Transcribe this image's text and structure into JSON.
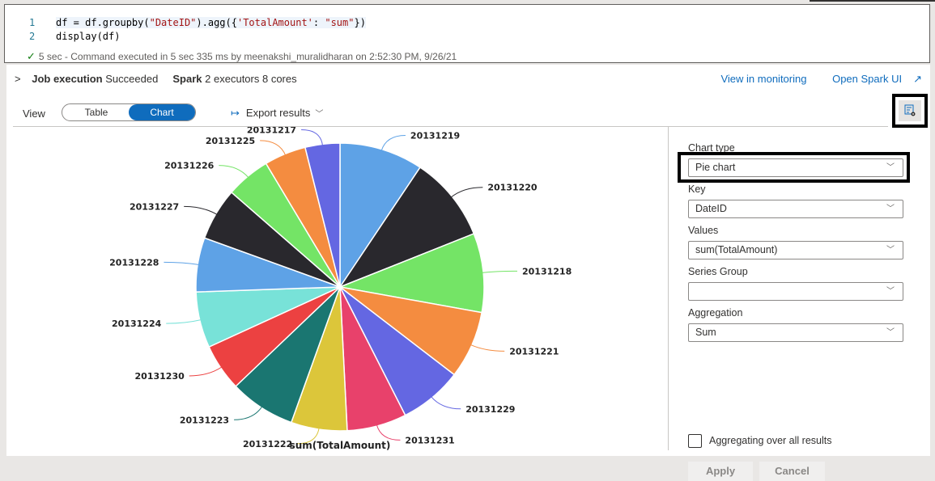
{
  "code_cell": {
    "lines": [
      {
        "num": "1",
        "parts": [
          "df = df.groupby(",
          "\"DateID\"",
          ").agg({",
          "'TotalAmount'",
          ": ",
          "\"sum\"",
          "})"
        ]
      },
      {
        "num": "2",
        "parts": [
          "display(df)"
        ]
      }
    ],
    "status_check": "✓",
    "status_text": "5 sec - Command executed in 5 sec 335 ms by meenakshi_muralidharan on 2:52:30 PM, 9/26/21"
  },
  "job": {
    "chevron": ">",
    "job_label": "Job execution",
    "job_status": "Succeeded",
    "spark_label": "Spark",
    "spark_info": "2 executors 8 cores"
  },
  "links": {
    "monitoring": "View in monitoring",
    "spark_ui": "Open Spark UI",
    "spark_ui_icon": "↗"
  },
  "view": {
    "label": "View",
    "table": "Table",
    "chart": "Chart",
    "selected": "Chart",
    "export_icon": "↦",
    "export": "Export results",
    "export_caret": "﹀"
  },
  "settings": {
    "chart_type_label": "Chart type",
    "chart_type_value": "Pie chart",
    "key_label": "Key",
    "key_value": "DateID",
    "values_label": "Values",
    "values_value": "sum(TotalAmount)",
    "series_group_label": "Series Group",
    "series_group_value": "",
    "aggregation_label": "Aggregation",
    "aggregation_value": "Sum",
    "aggregate_all_label": "Aggregating over all results",
    "aggregate_all_checked": false,
    "apply": "Apply",
    "cancel": "Cancel",
    "caret": "﹀"
  },
  "chart_data": {
    "type": "pie",
    "title": "sum(TotalAmount)",
    "value_unit": "percent share (estimated)",
    "start_angle": "top, clockwise",
    "slices": [
      {
        "label": "20131219",
        "value": 9.4,
        "color": "#5ea2e6"
      },
      {
        "label": "20131220",
        "value": 9.6,
        "color": "#29282d"
      },
      {
        "label": "20131218",
        "value": 8.9,
        "color": "#74e466"
      },
      {
        "label": "20131221",
        "value": 7.6,
        "color": "#f48c40"
      },
      {
        "label": "20131229",
        "value": 7.1,
        "color": "#6467e2"
      },
      {
        "label": "20131231",
        "value": 6.7,
        "color": "#e8416b"
      },
      {
        "label": "20131222",
        "value": 6.3,
        "color": "#dcc63a"
      },
      {
        "label": "20131223",
        "value": 7.4,
        "color": "#1a7671"
      },
      {
        "label": "20131230",
        "value": 5.3,
        "color": "#ec4141"
      },
      {
        "label": "20131224",
        "value": 6.3,
        "color": "#78e2d8"
      },
      {
        "label": "20131228",
        "value": 6.1,
        "color": "#5ea2e6"
      },
      {
        "label": "20131227",
        "value": 5.9,
        "color": "#29282d"
      },
      {
        "label": "20131226",
        "value": 5.0,
        "color": "#74e466"
      },
      {
        "label": "20131225",
        "value": 4.7,
        "color": "#f48c40"
      },
      {
        "label": "20131217",
        "value": 3.9,
        "color": "#6467e2"
      }
    ]
  }
}
